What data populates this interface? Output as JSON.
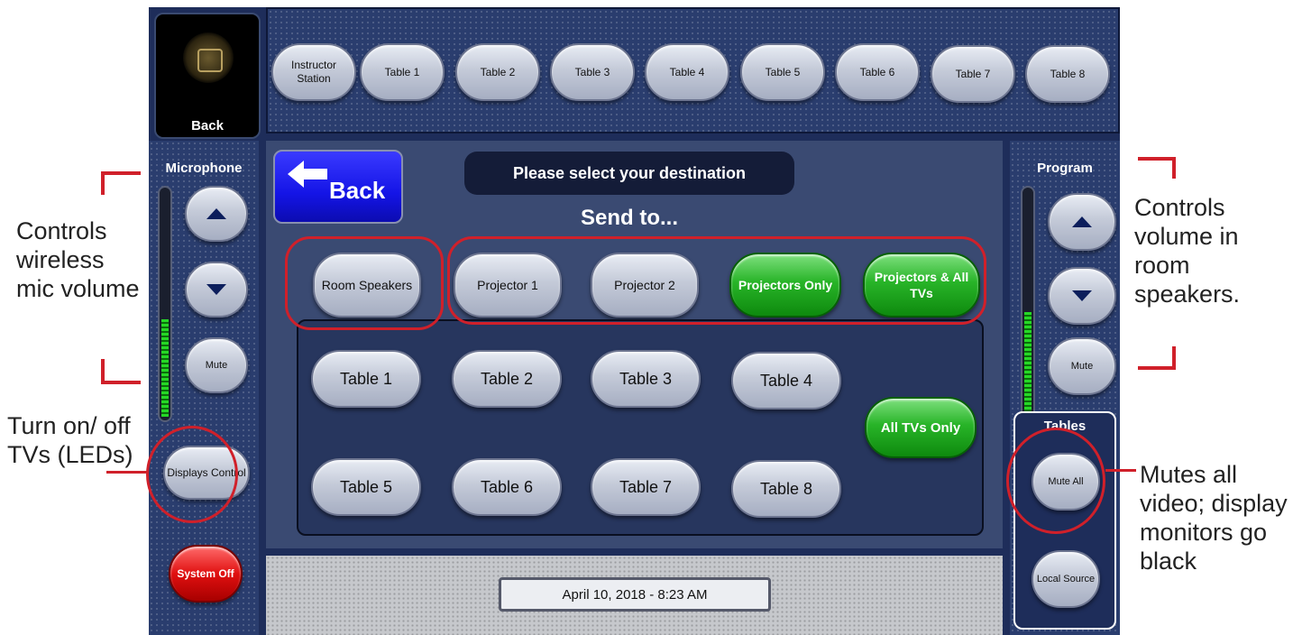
{
  "top_tabs": [
    "Instructor Station",
    "Table 1",
    "Table 2",
    "Table 3",
    "Table 4",
    "Table 5",
    "Table 6",
    "Table 7",
    "Table 8"
  ],
  "logo": {
    "back_label": "Back"
  },
  "left_panel": {
    "title": "Microphone",
    "mute": "Mute",
    "displays_control": "Displays Control",
    "system_off": "System Off",
    "meter_level": 0.42
  },
  "right_panel": {
    "title": "Program",
    "mute": "Mute",
    "tables_label": "Tables",
    "mute_all": "Mute All",
    "local_source": "Local Source",
    "meter_level": 0.45
  },
  "center": {
    "back_label": "Back",
    "header": "Please select your destination",
    "subheader": "Send to...",
    "room_speakers": "Room Speakers",
    "projector1": "Projector 1",
    "projector2": "Projector 2",
    "projectors_only": "Projectors Only",
    "projectors_all_tvs": "Projectors & All TVs",
    "tables": [
      "Table 1",
      "Table 2",
      "Table 3",
      "Table 4",
      "Table 5",
      "Table 6",
      "Table 7",
      "Table 8"
    ],
    "all_tvs_only": "All TVs Only"
  },
  "datetime": "April 10, 2018  -  8:23 AM",
  "annotations": {
    "mic": "Controls wireless mic volume",
    "tvs": "Turn on/ off TVs (LEDs)",
    "program": "Controls volume in room speakers.",
    "mute_all": "Mutes all video; display monitors go black"
  },
  "colors": {
    "panel": "#1e2d5a",
    "accent_green": "#28b428",
    "accent_red": "#e01010",
    "annotation_red": "#d0202a",
    "back_blue": "#1414e6"
  },
  "icons": [
    "emblem-icon",
    "arrow-left-icon",
    "arrow-up-icon",
    "arrow-down-icon"
  ]
}
